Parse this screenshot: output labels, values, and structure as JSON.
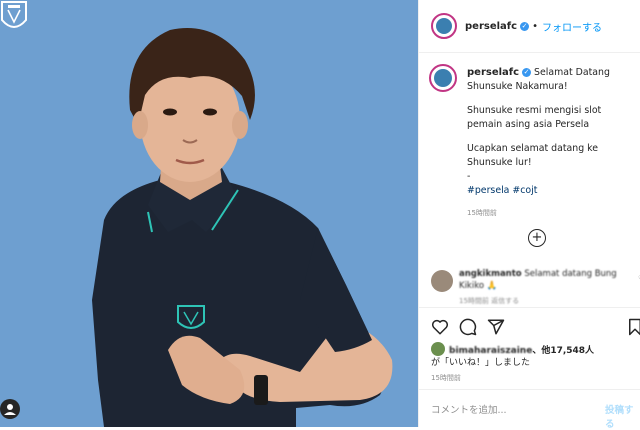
{
  "post": {
    "username": "perselafc",
    "follow_label": "フォローする",
    "caption_lines": [
      "Selamat Datang Shunsuke Nakamura!",
      "Shunsuke resmi mengisi slot pemain asing asia Persela",
      "Ucapkan selamat datang ke Shunsuke lur!\n-"
    ],
    "hashtags": "#persela #cojt",
    "time_ago": "15時間前",
    "load_more_icon": "plus-circle-icon"
  },
  "comment": {
    "username": "angkikmanto",
    "text": "Selamat datang Bung Kikiko 🙏",
    "meta": "15時間前   返信する"
  },
  "actions": {
    "like_icon": "heart-icon",
    "comment_icon": "comment-icon",
    "share_icon": "share-icon",
    "save_icon": "bookmark-icon"
  },
  "likes": {
    "liker": "bimaharaiszaine",
    "others": "、他17,548人",
    "suffix": "が「いいね！」しました",
    "time": "15時間前"
  },
  "add_comment": {
    "placeholder": "コメントを追加...",
    "post_label": "投稿する"
  },
  "colors": {
    "photo_background": "#6e9fd0",
    "shirt": "#1d2533",
    "accent_teal": "#2ec4b6",
    "link_blue": "#0095f6",
    "verified_blue": "#3897f0"
  }
}
